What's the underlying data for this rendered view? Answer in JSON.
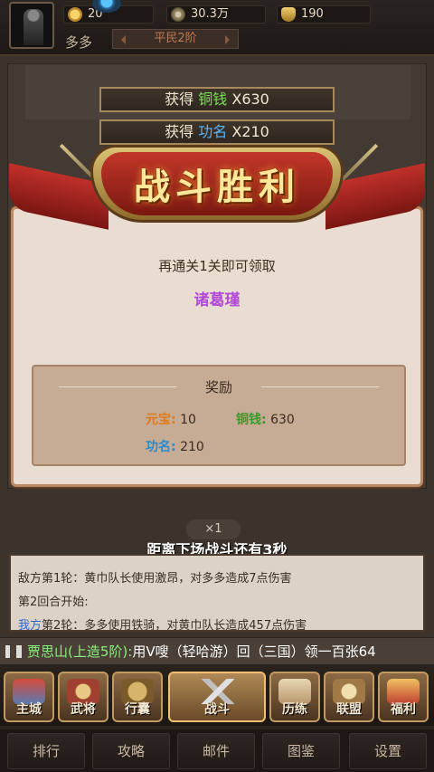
{
  "top": {
    "player_name": "多多",
    "rank": "平民2阶",
    "resources": [
      {
        "icon": "coin-icon",
        "value": "20"
      },
      {
        "icon": "copper-coin-icon",
        "value": "30.3万"
      },
      {
        "icon": "ingot-icon",
        "value": "190"
      }
    ]
  },
  "gains": [
    {
      "prefix": "获得",
      "item": "铜钱",
      "amount": "X630"
    },
    {
      "prefix": "获得",
      "item": "功名",
      "amount": "X210"
    }
  ],
  "banner": {
    "title": "战斗胜利"
  },
  "dialog": {
    "hint": "再通关1关即可领取",
    "hero_name": "诸葛瑾",
    "reward_title": "奖励",
    "rewards": [
      {
        "label": "元宝:",
        "value": "10"
      },
      {
        "label": "铜钱:",
        "value": "630"
      },
      {
        "label": "功名:",
        "value": "210"
      }
    ]
  },
  "speed": "×1",
  "countdown": "距离下场战斗还有3秒",
  "battle_log": [
    {
      "text": "敌方第1轮：黄巾队长使用激昂，对多多造成7点伤害"
    },
    {
      "text": "第2回合开始:"
    },
    {
      "prefix": "我方",
      "text": "第2轮：多多使用铁骑，对黄巾队长造成457点伤害"
    }
  ],
  "marquee": {
    "name": "贾思山(上造5阶):",
    "text": "用V嗖（轻哈游）回（三国）领一百张64"
  },
  "nav": [
    "主城",
    "武将",
    "行囊",
    "战斗",
    "历练",
    "联盟",
    "福利"
  ],
  "bottom_menu": [
    "排行",
    "攻略",
    "邮件",
    "图鉴",
    "设置"
  ],
  "colors": {
    "green": "#7be05a",
    "blue": "#58b6ff",
    "purple": "#b24ad9",
    "orange": "#e07a1a"
  }
}
